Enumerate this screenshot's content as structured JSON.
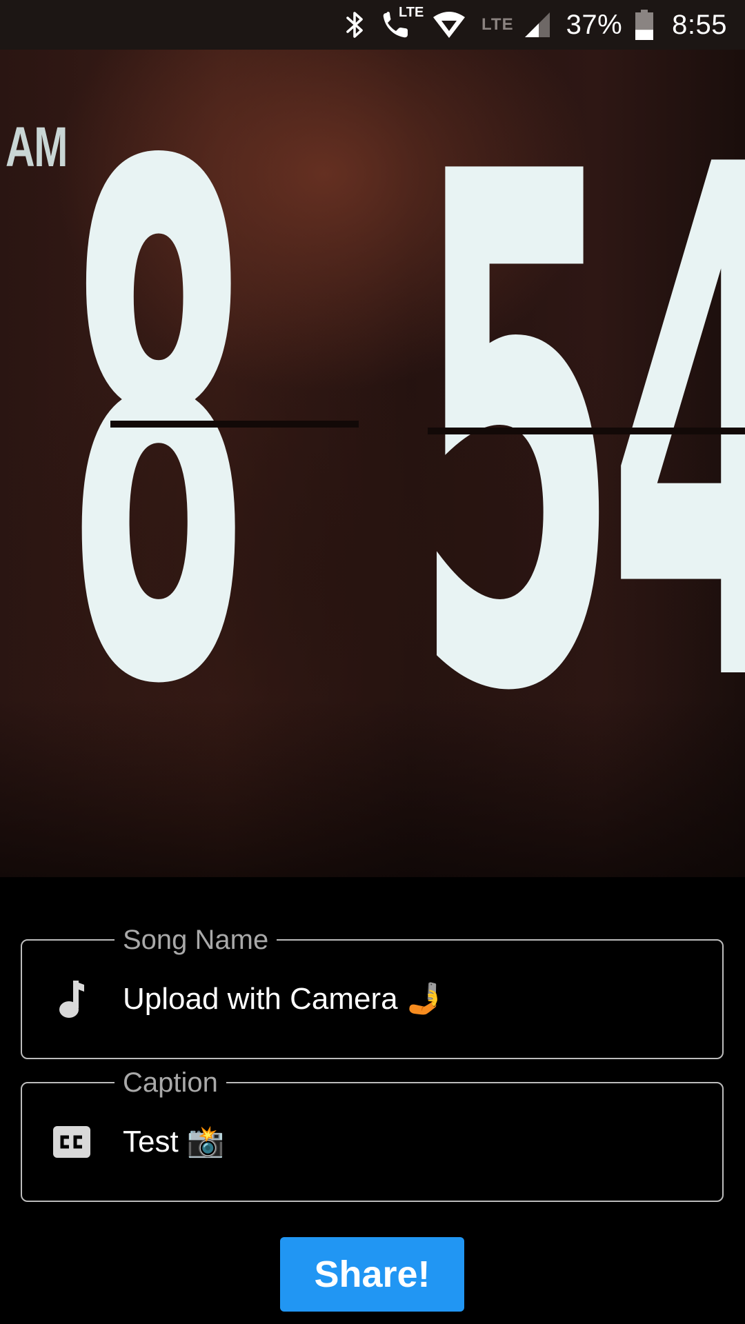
{
  "status_bar": {
    "bluetooth_icon": "bluetooth-icon",
    "volte_call_icon": "lte-call-icon",
    "volte_label": "LTE",
    "wifi_icon": "wifi-icon",
    "lte_label": "LTE",
    "signal_icon": "cell-signal-icon",
    "battery_percent": "37%",
    "battery_level": 0.37,
    "time": "8:55"
  },
  "photo": {
    "am_label": "AM",
    "hour_digit": "8",
    "minute_digit_1": "5",
    "minute_digit_2": "4"
  },
  "form": {
    "song_name": {
      "label": "Song Name",
      "value": "Upload with Camera 🤳",
      "icon": "music-note-icon"
    },
    "caption": {
      "label": "Caption",
      "value": "Test 📸",
      "icon": "closed-caption-icon"
    },
    "share_label": "Share!"
  },
  "colors": {
    "accent": "#2196F3",
    "field_border": "#BDBDBD",
    "label_gray": "#A9A9A9",
    "background": "#000000"
  }
}
